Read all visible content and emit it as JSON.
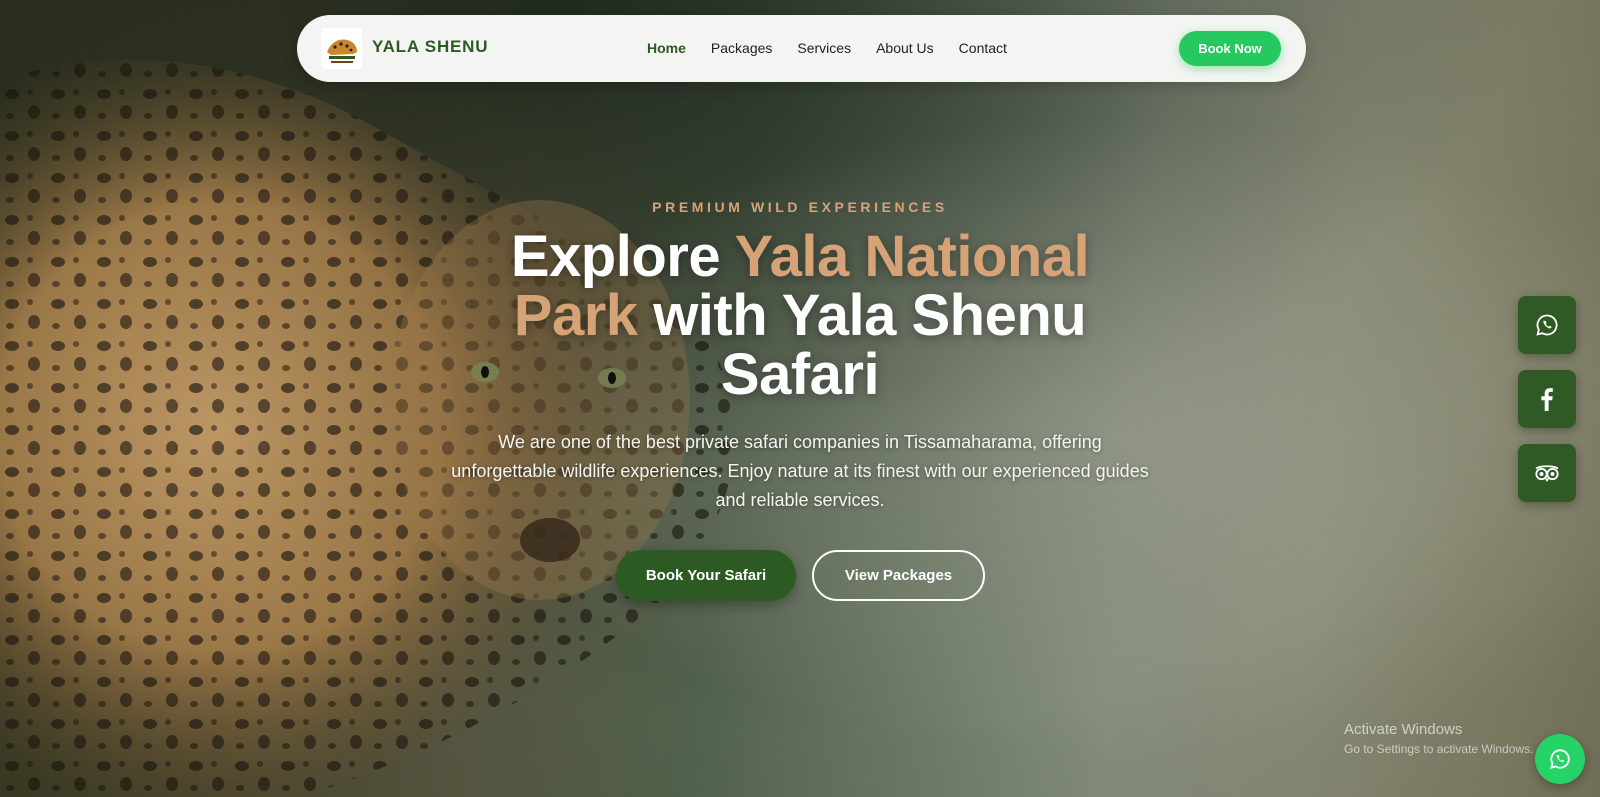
{
  "navbar": {
    "logo_icon": "leopard-logo-icon",
    "brand": "YALA SHENU",
    "links": [
      "Home",
      "Packages",
      "Services",
      "About Us",
      "Contact"
    ],
    "active_link": "Home",
    "cta": "Book Now"
  },
  "hero": {
    "eyebrow": "PREMIUM WILD EXPERIENCES",
    "headline": {
      "part1": "Explore ",
      "accent1": "Yala National",
      "accent2": "Park",
      "part2": " with Yala Shenu",
      "part3": "Safari"
    },
    "description_lines": [
      "We are one of the best private safari companies in Tissamaharama, offering",
      "unforgettable wildlife experiences. Enjoy nature at its finest with our experienced guides",
      "and reliable services."
    ],
    "primary_cta": "Book Your Safari",
    "secondary_cta": "View Packages"
  },
  "social": {
    "items": [
      {
        "icon": "whatsapp-icon"
      },
      {
        "icon": "facebook-icon"
      },
      {
        "icon": "tripadvisor-icon"
      }
    ]
  },
  "watermark": {
    "title": "Activate Windows",
    "subtitle": "Go to Settings to activate Windows."
  },
  "floating": {
    "icon": "whatsapp-icon"
  },
  "colors": {
    "brand_green": "#2d5a22",
    "accent_tan": "#d6a376",
    "cta_green": "#25c95f",
    "whatsapp_green": "#25d366"
  }
}
